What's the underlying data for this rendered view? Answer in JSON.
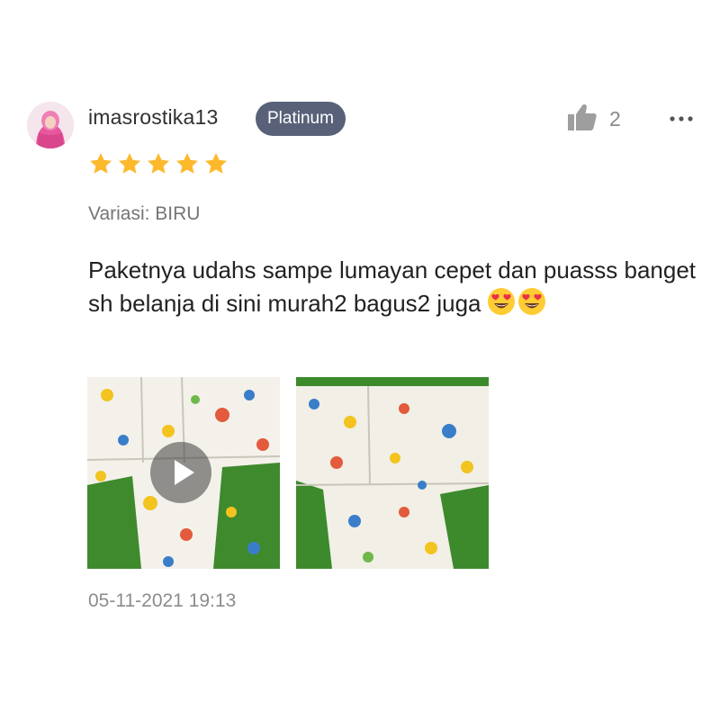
{
  "review": {
    "username": "imasrostika13",
    "badge": "Platinum",
    "likes": "2",
    "rating": 5,
    "max_rating": 5,
    "variation": "Variasi: BIRU",
    "comment": "Paketnya udahs sampe lumayan cepet dan puasss banget sh belanja di sini murah2 bagus2 juga",
    "comment_emojis": [
      "😍",
      "😍"
    ],
    "timestamp": "05-11-2021 19:13",
    "media": [
      {
        "kind": "video",
        "icon": "play-icon"
      },
      {
        "kind": "photo",
        "icon": ""
      }
    ]
  },
  "icons": {
    "like": "thumbs-up-icon",
    "more": "more-options-icon",
    "star": "star-icon",
    "emoji": "heart-eyes-emoji"
  },
  "colors": {
    "badge_bg": "#586178",
    "star": "#FDB92C",
    "grass": "#3E8A2C",
    "text_secondary": "#757575"
  }
}
